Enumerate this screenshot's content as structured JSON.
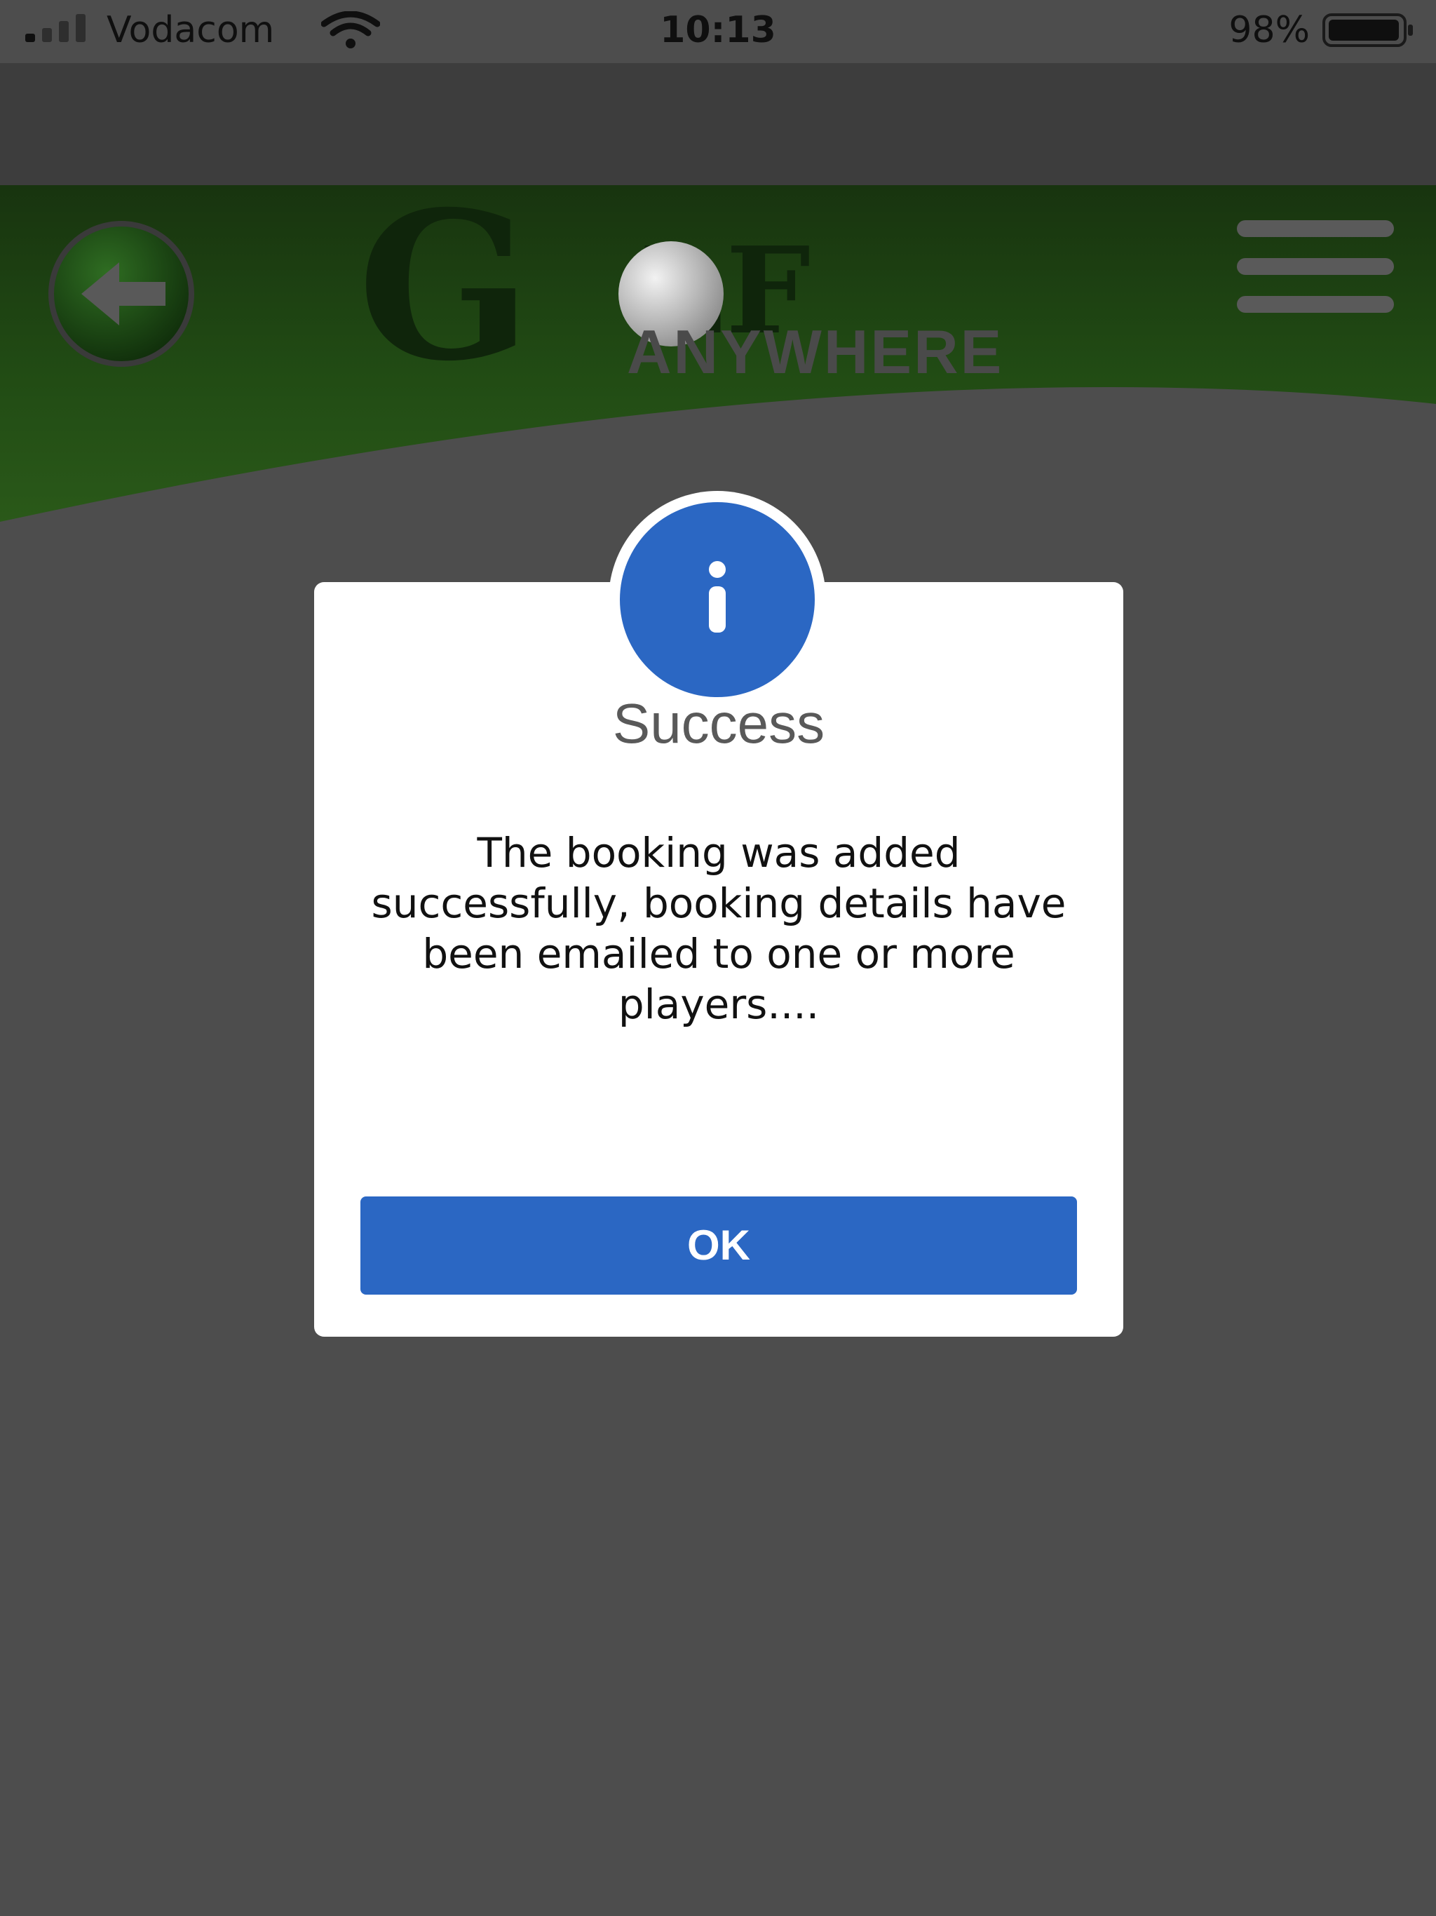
{
  "status_bar": {
    "carrier": "Vodacom",
    "time": "10:13",
    "battery_percent": "98%",
    "battery_level": 0.98,
    "signal_icon": "cellular-signal-icon",
    "wifi_icon": "wifi-icon",
    "battery_icon": "battery-icon"
  },
  "header": {
    "back_icon": "back-arrow-icon",
    "menu_icon": "hamburger-menu-icon",
    "logo": {
      "big_letter": "G",
      "small_letters": "LF",
      "subtitle": "ANYWHERE"
    }
  },
  "dialog": {
    "icon": "info-icon",
    "title": "Success",
    "message": "The booking was added successfully, booking details have been emailed to one or more players....",
    "ok_label": "OK"
  },
  "colors": {
    "page_background": "#4d4d4d",
    "header_green": "#1f4d13",
    "accent_blue": "#2b67c3",
    "dialog_background": "#ffffff"
  }
}
